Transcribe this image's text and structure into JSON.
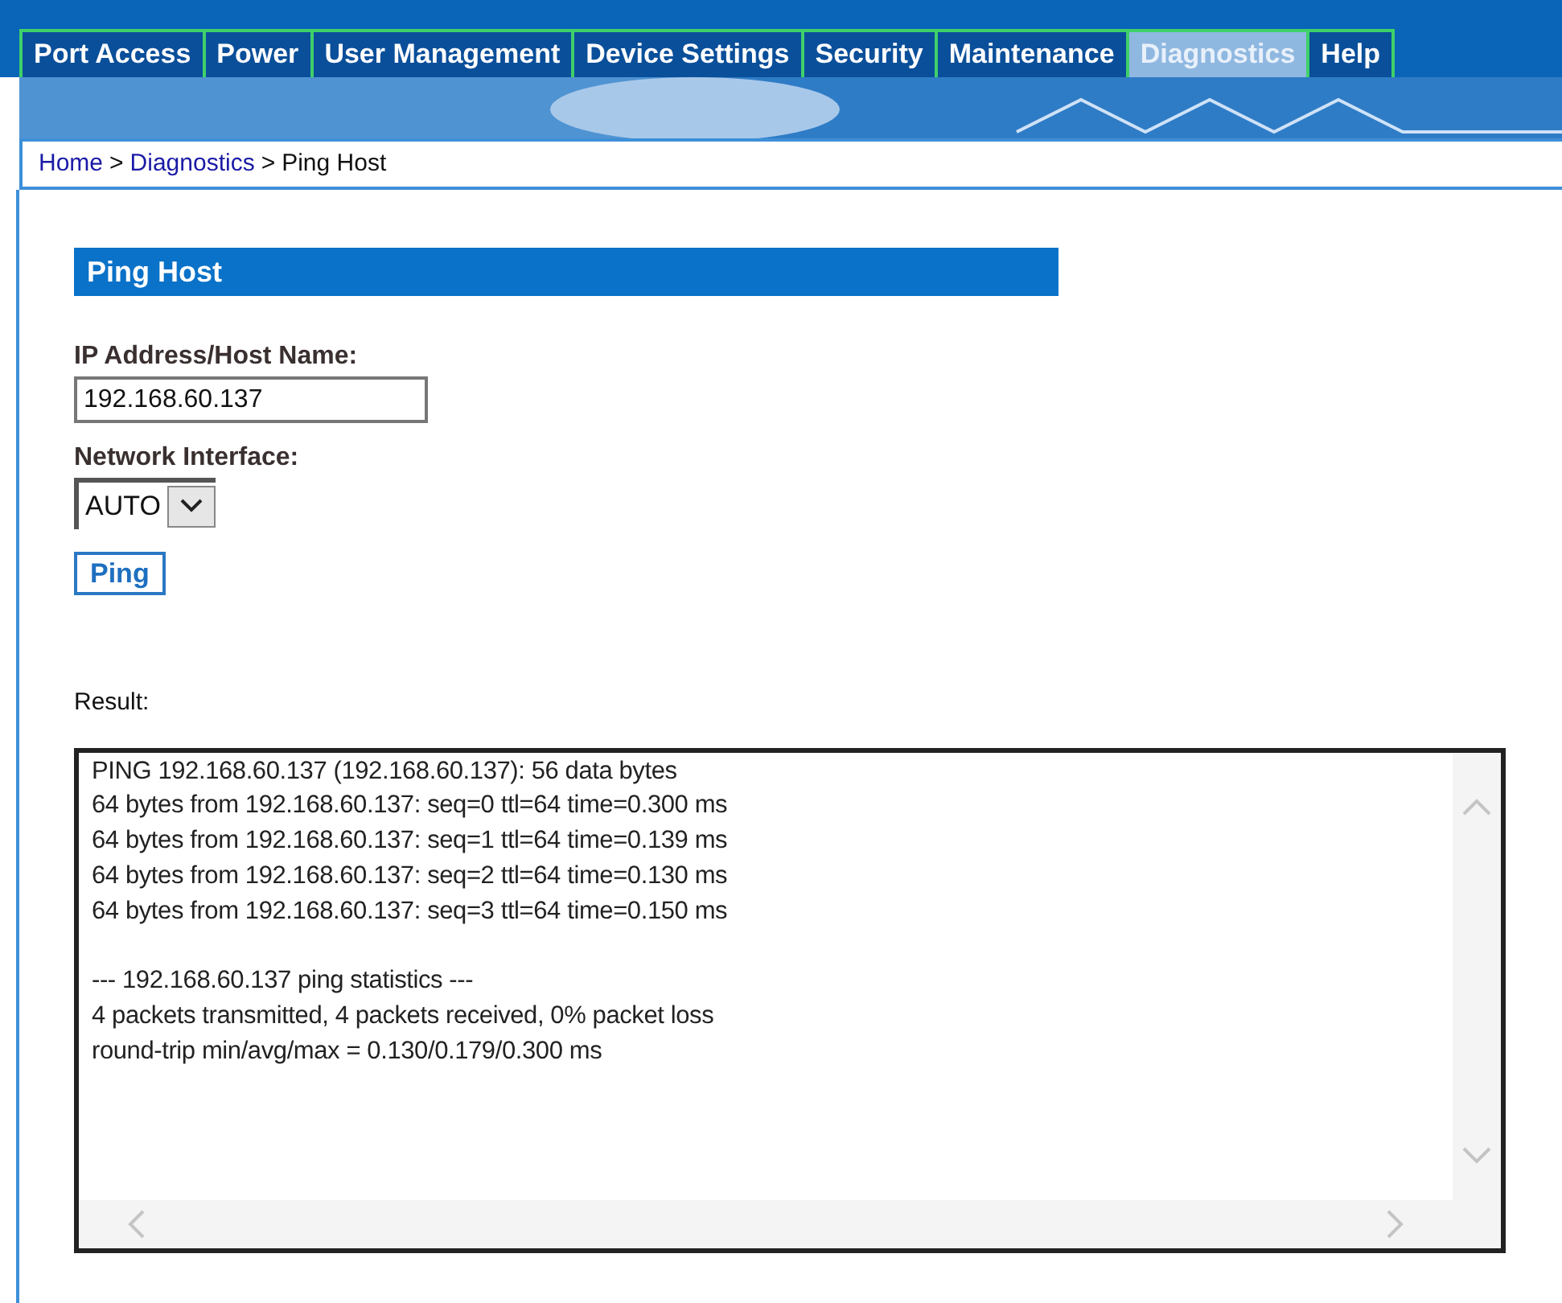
{
  "tabs": [
    {
      "label": "Port Access",
      "selected": false
    },
    {
      "label": "Power",
      "selected": false
    },
    {
      "label": "User Management",
      "selected": false
    },
    {
      "label": "Device Settings",
      "selected": false
    },
    {
      "label": "Security",
      "selected": false
    },
    {
      "label": "Maintenance",
      "selected": false
    },
    {
      "label": "Diagnostics",
      "selected": true
    },
    {
      "label": "Help",
      "selected": false
    }
  ],
  "breadcrumb": [
    {
      "label": "Home",
      "kind": "link"
    },
    {
      "label": ">",
      "kind": "separator"
    },
    {
      "label": "Diagnostics",
      "kind": "link"
    },
    {
      "label": ">",
      "kind": "separator"
    },
    {
      "label": "Ping Host",
      "kind": "current"
    }
  ],
  "panel": {
    "title": "Ping Host",
    "host_field": {
      "label": "IP Address/Host Name:",
      "value": "192.168.60.137"
    },
    "interface_field": {
      "label": "Network Interface:",
      "value": "AUTO"
    },
    "ping_button": "Ping",
    "result": {
      "label": "Result:",
      "blocks": [
        {
          "lines": [
            "PING 192.168.60.137 (192.168.60.137): 56 data bytes",
            "64 bytes from 192.168.60.137: seq=0 ttl=64 time=0.300 ms",
            "64 bytes from 192.168.60.137: seq=1 ttl=64 time=0.139 ms",
            "64 bytes from 192.168.60.137: seq=2 ttl=64 time=0.130 ms",
            "64 bytes from 192.168.60.137: seq=3 ttl=64 time=0.150 ms"
          ]
        },
        {
          "lines": [
            "--- 192.168.60.137 ping statistics ---",
            "4 packets transmitted, 4 packets received, 0% packet loss",
            "round-trip min/avg/max = 0.130/0.179/0.300 ms"
          ]
        }
      ]
    }
  }
}
